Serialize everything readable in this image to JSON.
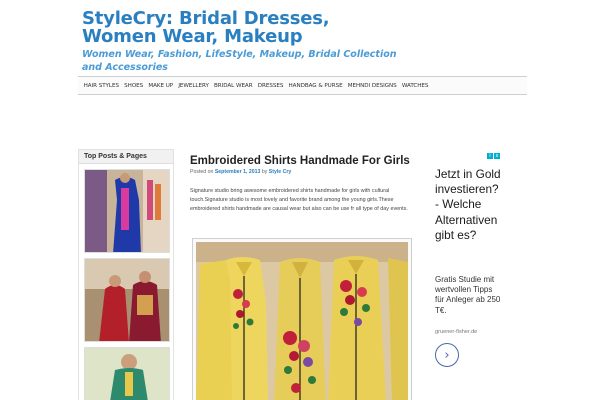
{
  "site": {
    "title": "StyleCry: Bridal Dresses, Women Wear, Makeup",
    "tagline": "Women Wear, Fashion, LifeStyle, Makeup, Bridal Collection and Accessories"
  },
  "nav": {
    "items": [
      "HAIR STYLES",
      "SHOES",
      "MAKE UP",
      "JEWELLERY",
      "BRIDAL WEAR",
      "DRESSES",
      "HANDBAG & PURSE",
      "MEHNDI DESIGNS",
      "WATCHES"
    ]
  },
  "sidebar": {
    "widget_title": "Top Posts & Pages"
  },
  "post": {
    "title": "Embroidered Shirts Handmade For Girls",
    "posted_on": "Posted on",
    "date": "September 1, 2013",
    "by": "by",
    "author": "Style Cry",
    "excerpt": "Signature studio bring awesome embroidered shirts handmade for girls  with cultural touch.Signature studio  is most lovely and favorite brand among the young girls.These embroidered shirts handmade are causal wear but also can be use fr all type of day events."
  },
  "ad": {
    "badge_info": "i",
    "badge_close": "x",
    "headline": "Jetzt in Gold investieren? - Welche Alternativen gibt es?",
    "body": "Gratis Studie mit wertvollen Tipps für Anleger ab 250 T€.",
    "domain": "gruener-fisher.de",
    "arrow_icon": "›"
  },
  "colors": {
    "brand": "#2a7fc1",
    "ad_accent": "#00aecd",
    "dress_yellow": "#e9cf52"
  }
}
